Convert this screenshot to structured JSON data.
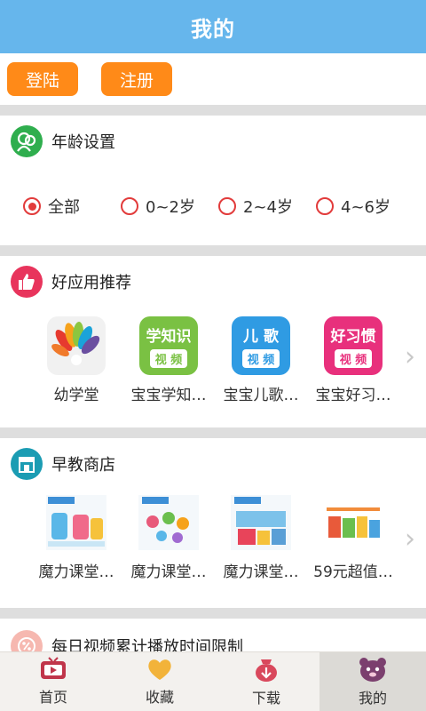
{
  "header": {
    "title": "我的"
  },
  "auth": {
    "login": "登陆",
    "register": "注册"
  },
  "age_section": {
    "title": "年龄设置",
    "options": [
      "全部",
      "0~2岁",
      "2~4岁",
      "4~6岁"
    ],
    "selected": "全部"
  },
  "apps_section": {
    "title": "好应用推荐",
    "apps": [
      {
        "name": "幼学堂",
        "icon": "peacock-icon"
      },
      {
        "name": "宝宝学知…",
        "icon_line1": "学知识",
        "icon_line2": "视 频"
      },
      {
        "name": "宝宝儿歌…",
        "icon_line1": "儿 歌",
        "icon_line2": "视 频"
      },
      {
        "name": "宝宝好习…",
        "icon_line1": "好习惯",
        "icon_line2": "视 频"
      }
    ]
  },
  "store_section": {
    "title": "早教商店",
    "items": [
      {
        "name": "魔力课堂…"
      },
      {
        "name": "魔力课堂…"
      },
      {
        "name": "魔力课堂…"
      },
      {
        "name": "59元超值…"
      }
    ]
  },
  "limit_section": {
    "title": "每日视频累计播放时间限制"
  },
  "tabs": [
    {
      "label": "首页",
      "icon": "tv-icon"
    },
    {
      "label": "收藏",
      "icon": "heart-icon"
    },
    {
      "label": "下载",
      "icon": "download-bag-icon"
    },
    {
      "label": "我的",
      "icon": "bear-icon",
      "active": true
    }
  ],
  "colors": {
    "header": "#66b6ec",
    "button": "#ff8a18",
    "radio": "#e23b3b"
  }
}
